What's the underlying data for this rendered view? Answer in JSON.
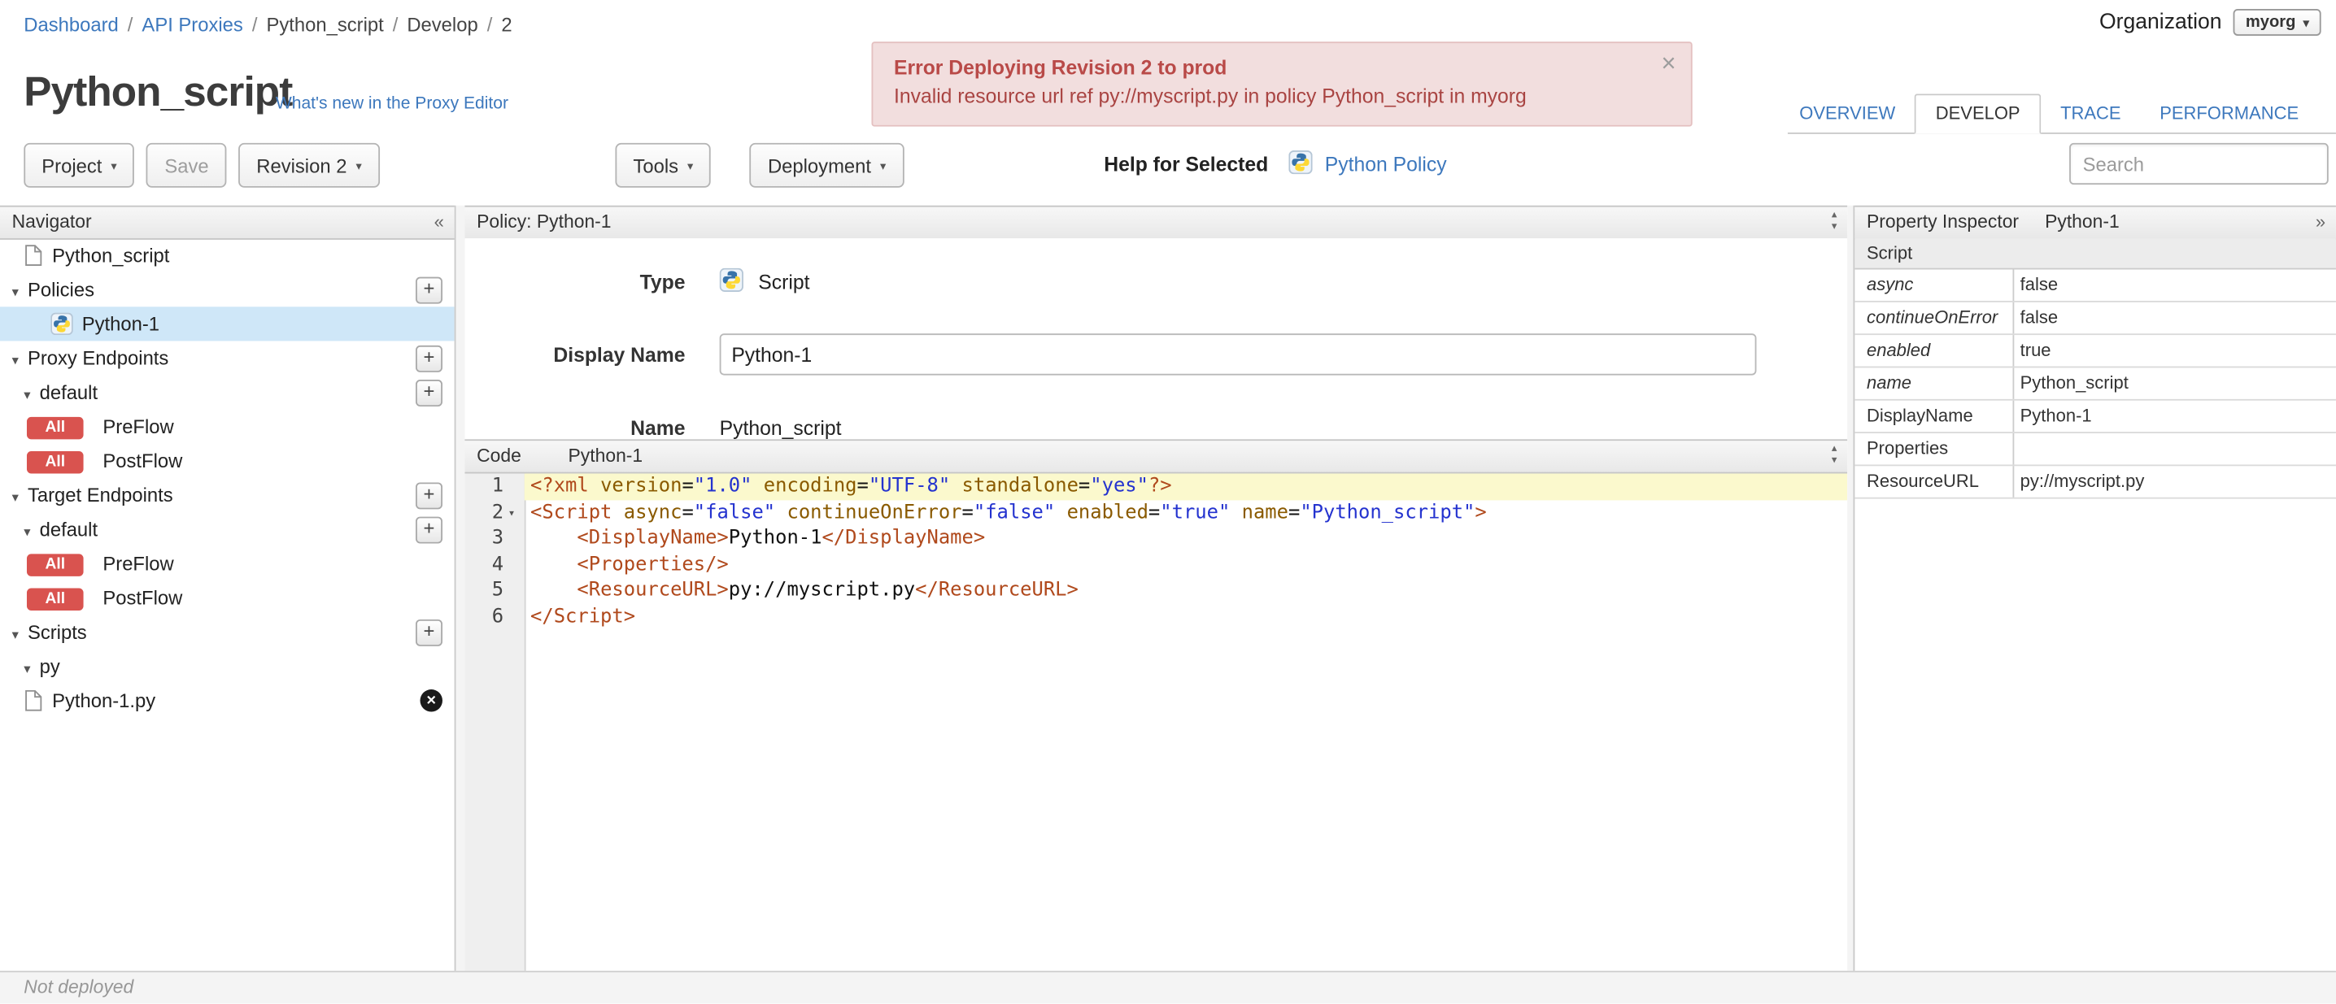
{
  "breadcrumb": {
    "separator": "/",
    "items": [
      {
        "label": "Dashboard",
        "link": true
      },
      {
        "label": "API Proxies",
        "link": true
      },
      {
        "label": "Python_script",
        "link": false
      },
      {
        "label": "Develop",
        "link": false
      },
      {
        "label": "2",
        "link": false
      }
    ]
  },
  "organization": {
    "label": "Organization",
    "value": "myorg",
    "caret": "▾"
  },
  "error_banner": {
    "title": "Error Deploying Revision 2 to prod",
    "message": "Invalid resource url ref py://myscript.py in policy Python_script in myorg",
    "close_icon": "×"
  },
  "page": {
    "title": "Python_script",
    "whats_new_link": "What's new in the Proxy Editor"
  },
  "tabs": [
    {
      "label": "OVERVIEW",
      "active": false
    },
    {
      "label": "DEVELOP",
      "active": true
    },
    {
      "label": "TRACE",
      "active": false
    },
    {
      "label": "PERFORMANCE",
      "active": false
    }
  ],
  "toolbar": {
    "project_label": "Project",
    "save_label": "Save",
    "revision_label": "Revision 2",
    "tools_label": "Tools",
    "deployment_label": "Deployment",
    "help_for_selected_label": "Help for Selected",
    "policy_link_label": "Python Policy",
    "search_placeholder": "Search",
    "caret": "▾"
  },
  "navigator": {
    "title": "Navigator",
    "collapse_icon": "«",
    "triangle_icon": "▾",
    "plus_icon": "+",
    "delete_icon": "✕",
    "items": [
      {
        "type": "leaf",
        "label": "Python_script",
        "icon": "file"
      },
      {
        "type": "section",
        "label": "Policies",
        "plus": true
      },
      {
        "type": "leaf",
        "label": "Python-1",
        "icon": "python",
        "selected": true,
        "indent": 1
      },
      {
        "type": "section",
        "label": "Proxy Endpoints",
        "plus": true
      },
      {
        "type": "subsection",
        "label": "default",
        "plus": true
      },
      {
        "type": "flow",
        "label": "PreFlow",
        "badge": "All"
      },
      {
        "type": "flow",
        "label": "PostFlow",
        "badge": "All"
      },
      {
        "type": "section",
        "label": "Target Endpoints",
        "plus": true
      },
      {
        "type": "subsection",
        "label": "default",
        "plus": true
      },
      {
        "type": "flow",
        "label": "PreFlow",
        "badge": "All"
      },
      {
        "type": "flow",
        "label": "PostFlow",
        "badge": "All"
      },
      {
        "type": "section",
        "label": "Scripts",
        "plus": true
      },
      {
        "type": "subsection",
        "label": "py"
      },
      {
        "type": "leaf",
        "label": "Python-1.py",
        "icon": "file",
        "del": true
      }
    ]
  },
  "policy_panel": {
    "header": "Policy: Python-1",
    "type_label": "Type",
    "type_value": "Script",
    "display_name_label": "Display Name",
    "display_name_value": "Python-1",
    "name_label": "Name",
    "name_value": "Python_script"
  },
  "code_panel": {
    "header_label": "Code",
    "header_name": "Python-1",
    "lines": [
      {
        "tokens": [
          {
            "c": "tag",
            "v": "<?xml"
          },
          {
            "c": "plain",
            "v": " "
          },
          {
            "c": "attr",
            "v": "version"
          },
          {
            "c": "plain",
            "v": "="
          },
          {
            "c": "str",
            "v": "\"1.0\""
          },
          {
            "c": "plain",
            "v": " "
          },
          {
            "c": "attr",
            "v": "encoding"
          },
          {
            "c": "plain",
            "v": "="
          },
          {
            "c": "str",
            "v": "\"UTF-8\""
          },
          {
            "c": "plain",
            "v": " "
          },
          {
            "c": "attr",
            "v": "standalone"
          },
          {
            "c": "plain",
            "v": "="
          },
          {
            "c": "str",
            "v": "\"yes\""
          },
          {
            "c": "tag",
            "v": "?>"
          }
        ]
      },
      {
        "fold": true,
        "tokens": [
          {
            "c": "tag",
            "v": "<Script"
          },
          {
            "c": "plain",
            "v": " "
          },
          {
            "c": "attr",
            "v": "async"
          },
          {
            "c": "plain",
            "v": "="
          },
          {
            "c": "str",
            "v": "\"false\""
          },
          {
            "c": "plain",
            "v": " "
          },
          {
            "c": "attr",
            "v": "continueOnError"
          },
          {
            "c": "plain",
            "v": "="
          },
          {
            "c": "str",
            "v": "\"false\""
          },
          {
            "c": "plain",
            "v": " "
          },
          {
            "c": "attr",
            "v": "enabled"
          },
          {
            "c": "plain",
            "v": "="
          },
          {
            "c": "str",
            "v": "\"true\""
          },
          {
            "c": "plain",
            "v": " "
          },
          {
            "c": "attr",
            "v": "name"
          },
          {
            "c": "plain",
            "v": "="
          },
          {
            "c": "str",
            "v": "\"Python_script\""
          },
          {
            "c": "tag",
            "v": ">"
          }
        ]
      },
      {
        "tokens": [
          {
            "c": "plain",
            "v": "    "
          },
          {
            "c": "tag",
            "v": "<DisplayName>"
          },
          {
            "c": "plain",
            "v": "Python-1"
          },
          {
            "c": "tag",
            "v": "</DisplayName>"
          }
        ]
      },
      {
        "tokens": [
          {
            "c": "plain",
            "v": "    "
          },
          {
            "c": "tag",
            "v": "<Properties/>"
          }
        ]
      },
      {
        "tokens": [
          {
            "c": "plain",
            "v": "    "
          },
          {
            "c": "tag",
            "v": "<ResourceURL>"
          },
          {
            "c": "plain",
            "v": "py://myscript.py"
          },
          {
            "c": "tag",
            "v": "</ResourceURL>"
          }
        ]
      },
      {
        "tokens": [
          {
            "c": "tag",
            "v": "</Script>"
          }
        ]
      }
    ]
  },
  "property_inspector": {
    "title": "Property Inspector",
    "subtitle": "Python-1",
    "expand_icon": "»",
    "section_header": "Script",
    "rows": [
      {
        "name": "async",
        "value": "false",
        "italic": true
      },
      {
        "name": "continueOnError",
        "value": "false",
        "italic": true
      },
      {
        "name": "enabled",
        "value": "true",
        "italic": true
      },
      {
        "name": "name",
        "value": "Python_script",
        "italic": true
      },
      {
        "name": "DisplayName",
        "value": "Python-1",
        "italic": false
      },
      {
        "name": "Properties",
        "value": "",
        "italic": false
      },
      {
        "name": "ResourceURL",
        "value": "py://myscript.py",
        "italic": false
      }
    ]
  },
  "status_bar": {
    "text": "Not deployed"
  },
  "colors": {
    "accent_blue": "#3d78bd",
    "badge_red": "#d9534f",
    "error_bg": "#f2dede",
    "error_text": "#a94442",
    "selected_row": "#cfe7f8",
    "token_string": "#2433cf",
    "token_tag": "#b0491c",
    "token_attr": "#8a5a00",
    "active_line": "#fbf9cd"
  }
}
